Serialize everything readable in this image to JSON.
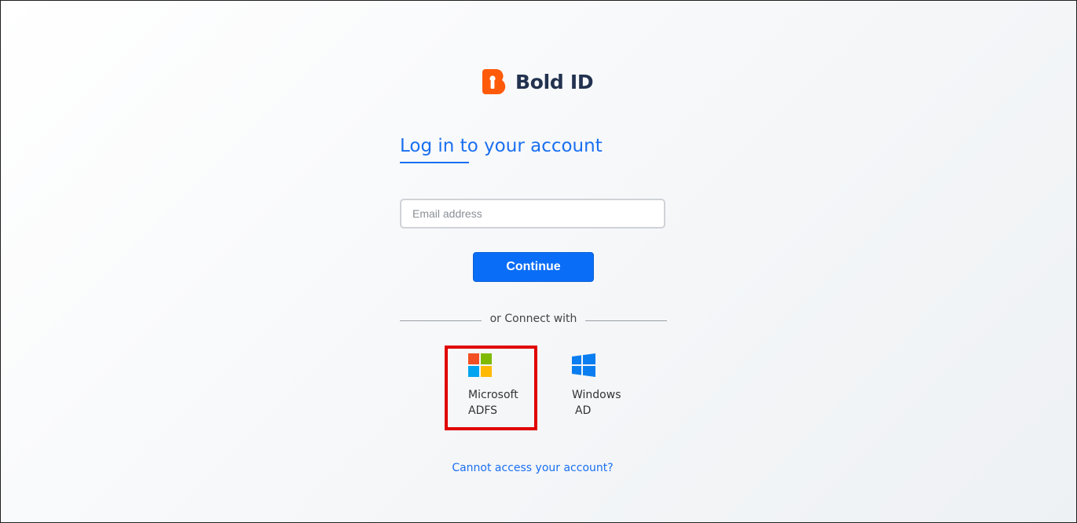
{
  "brand": {
    "name": "Bold ID",
    "icon": "bold-id-logo-icon",
    "accent_color": "#ff5a0a",
    "text_color": "#22324f"
  },
  "login": {
    "title": "Log in to your account",
    "email_placeholder": "Email address",
    "email_value": "",
    "continue_label": "Continue",
    "divider_text": "or Connect with",
    "help_link": "Cannot access your account?"
  },
  "providers": [
    {
      "line1": "Microsoft",
      "line2": "ADFS",
      "icon": "microsoft-icon"
    },
    {
      "line1": "Windows",
      "line2": "AD",
      "icon": "windows-icon"
    }
  ],
  "colors": {
    "primary": "#0a6df7",
    "link": "#1a6ff0",
    "highlight": "#e00000"
  }
}
